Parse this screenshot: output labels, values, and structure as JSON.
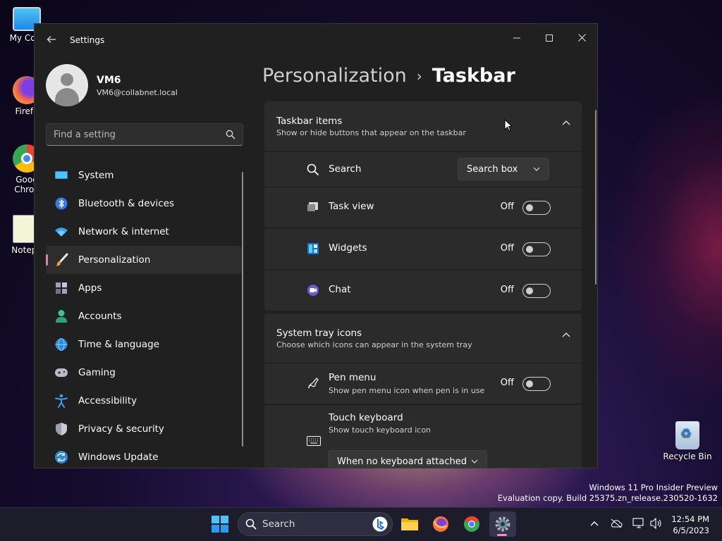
{
  "desktop": {
    "icons": [
      {
        "label": "My Com"
      },
      {
        "label": "Firefo"
      },
      {
        "label": "Goog"
      },
      {
        "label": "Chron"
      },
      {
        "label": "Notepa"
      },
      {
        "label": "Recycle Bin"
      }
    ]
  },
  "window": {
    "title": "Settings",
    "controls": {
      "minimize": "—",
      "maximize": "☐",
      "close": "✕"
    }
  },
  "profile": {
    "name": "VM6",
    "email": "VM6@collabnet.local"
  },
  "search": {
    "placeholder": "Find a setting"
  },
  "nav": {
    "items": [
      {
        "label": "System",
        "icon": "monitor-icon"
      },
      {
        "label": "Bluetooth & devices",
        "icon": "bluetooth-icon"
      },
      {
        "label": "Network & internet",
        "icon": "wifi-icon"
      },
      {
        "label": "Personalization",
        "icon": "brush-icon",
        "active": true
      },
      {
        "label": "Apps",
        "icon": "apps-icon"
      },
      {
        "label": "Accounts",
        "icon": "person-icon"
      },
      {
        "label": "Time & language",
        "icon": "globe-clock-icon"
      },
      {
        "label": "Gaming",
        "icon": "gamepad-icon"
      },
      {
        "label": "Accessibility",
        "icon": "accessibility-icon"
      },
      {
        "label": "Privacy & security",
        "icon": "shield-icon"
      },
      {
        "label": "Windows Update",
        "icon": "update-icon"
      }
    ]
  },
  "breadcrumb": {
    "parent": "Personalization",
    "separator": "›",
    "current": "Taskbar"
  },
  "taskbar_items": {
    "title": "Taskbar items",
    "description": "Show or hide buttons that appear on the taskbar",
    "rows": [
      {
        "label": "Search",
        "dropdown_value": "Search box"
      },
      {
        "label": "Task view",
        "state": "Off"
      },
      {
        "label": "Widgets",
        "state": "Off"
      },
      {
        "label": "Chat",
        "state": "Off"
      }
    ]
  },
  "system_tray": {
    "title": "System tray icons",
    "description": "Choose which icons can appear in the system tray",
    "rows": [
      {
        "label": "Pen menu",
        "sub": "Show pen menu icon when pen is in use",
        "state": "Off"
      },
      {
        "label": "Touch keyboard",
        "sub": "Show touch keyboard icon",
        "dropdown_value": "When no keyboard attached"
      }
    ]
  },
  "watermark": {
    "line1": "Windows 11 Pro Insider Preview",
    "line2": "Evaluation copy. Build 25375.zn_release.230520-1632"
  },
  "taskbar": {
    "search_placeholder": "Search",
    "time": "12:54 PM",
    "date": "6/5/2023"
  },
  "colors": {
    "accent": "#ff6fb1",
    "window_bg": "#202020",
    "card_bg": "#2b2b2b"
  }
}
